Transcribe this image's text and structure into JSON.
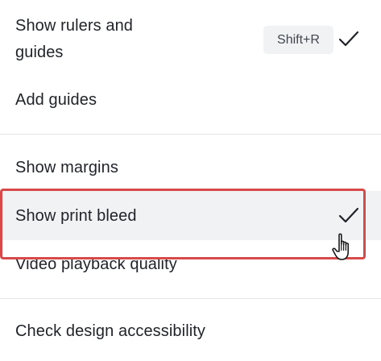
{
  "menu": {
    "items": [
      {
        "label": "Show rulers and guides",
        "shortcut": "Shift+R",
        "checked": true
      },
      {
        "label": "Add guides",
        "checked": false
      },
      {
        "label": "Show margins",
        "checked": false
      },
      {
        "label": "Show print bleed",
        "checked": true,
        "hovered": true
      },
      {
        "label": "Video playback quality",
        "checked": false
      },
      {
        "label": "Check design accessibility",
        "checked": false
      }
    ]
  },
  "icons": {
    "check": "check-icon",
    "cursor": "hand-pointer-icon"
  },
  "colors": {
    "text": "#1f2328",
    "hover_bg": "#f1f2f4",
    "kbd_bg": "#f1f2f4",
    "divider": "#e3e5e8",
    "annotation": "#d84a4a"
  }
}
